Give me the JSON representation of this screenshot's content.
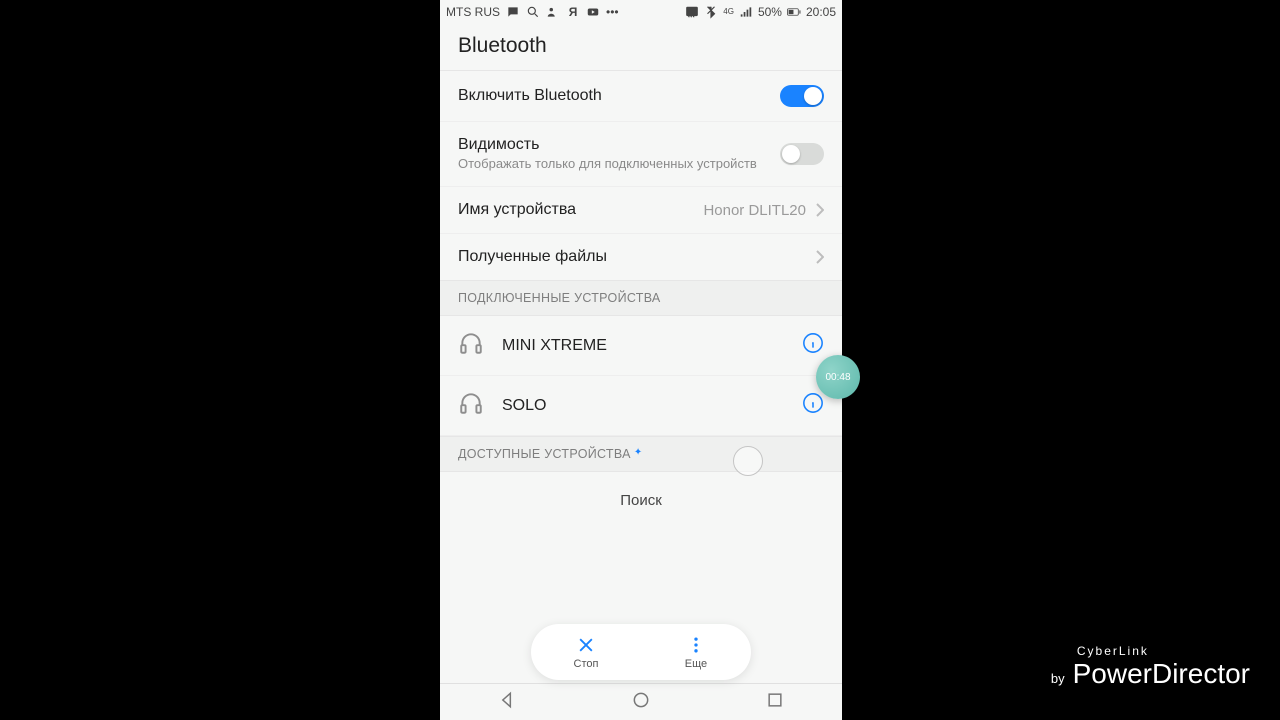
{
  "statusbar": {
    "carrier": "MTS RUS",
    "battery": "50%",
    "time": "20:05",
    "signal4g": "4G"
  },
  "header": {
    "title": "Bluetooth"
  },
  "rows": {
    "enable": {
      "label": "Включить Bluetooth",
      "on": true
    },
    "visibility": {
      "label": "Видимость",
      "sub": "Отображать только для подключенных устройств",
      "on": false
    },
    "name": {
      "label": "Имя устройства",
      "value": "Honor DLITL20"
    },
    "received": {
      "label": "Полученные файлы"
    }
  },
  "sections": {
    "paired": "ПОДКЛЮЧЕННЫЕ УСТРОЙСТВА",
    "available": "ДОСТУПНЫЕ УСТРОЙСТВА"
  },
  "devices": {
    "paired": [
      {
        "name": "MINI XTREME"
      },
      {
        "name": "SOLO"
      }
    ]
  },
  "scan": {
    "label": "Поиск"
  },
  "actions": {
    "stop": "Стоп",
    "more": "Еще"
  },
  "recorder": {
    "time": "00:48"
  },
  "watermark": {
    "brand": "CyberLink",
    "by": "by",
    "product": "PowerDirector"
  }
}
